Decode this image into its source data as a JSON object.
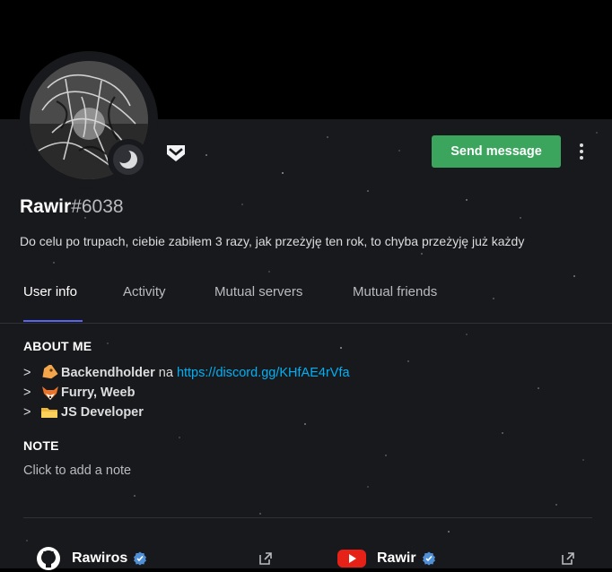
{
  "profile": {
    "username": "Rawir",
    "discriminator": "#6038",
    "bio": "Do celu po trupach, ciebie zabiłem 3 razy, jak przeżyję ten rok, to chyba przeżyję już każdy",
    "status": "idle"
  },
  "actions": {
    "send_message": "Send message"
  },
  "tabs": [
    {
      "label": "User info",
      "active": true
    },
    {
      "label": "Activity",
      "active": false
    },
    {
      "label": "Mutual servers",
      "active": false
    },
    {
      "label": "Mutual friends",
      "active": false
    }
  ],
  "about": {
    "title": "ABOUT ME",
    "lines": [
      {
        "prefix": ">",
        "icon": "label-tag-icon",
        "bold": "Backendholder",
        "text": " na ",
        "link": "https://discord.gg/KHfAE4rVfa"
      },
      {
        "prefix": ">",
        "icon": "fox-icon",
        "bold": "Furry, Weeb",
        "text": "",
        "link": ""
      },
      {
        "prefix": ">",
        "icon": "folder-icon",
        "bold": "JS Developer",
        "text": "",
        "link": ""
      }
    ]
  },
  "note": {
    "title": "NOTE",
    "placeholder": "Click to add a note"
  },
  "connections": [
    {
      "service": "github",
      "icon": "github-icon",
      "name": "Rawiros",
      "verified": true
    },
    {
      "service": "youtube",
      "icon": "youtube-icon",
      "name": "Rawir",
      "verified": true
    }
  ],
  "colors": {
    "accent": "#5865f2",
    "send_button": "#3ba55d",
    "link": "#00b0f4",
    "panel": "#18191c",
    "youtube": "#ff0000",
    "verified": "#4f8fd6"
  }
}
